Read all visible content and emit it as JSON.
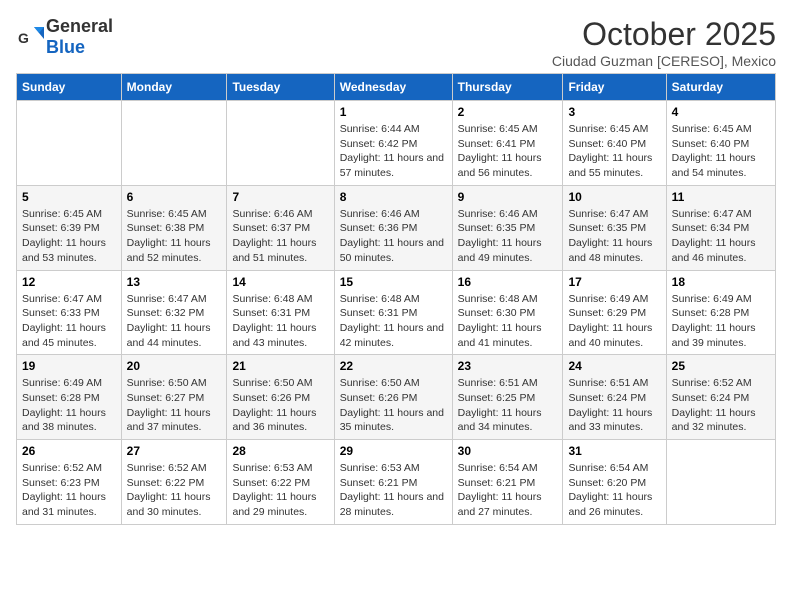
{
  "header": {
    "logo_general": "General",
    "logo_blue": "Blue",
    "title": "October 2025",
    "subtitle": "Ciudad Guzman [CERESO], Mexico"
  },
  "weekdays": [
    "Sunday",
    "Monday",
    "Tuesday",
    "Wednesday",
    "Thursday",
    "Friday",
    "Saturday"
  ],
  "weeks": [
    [
      {
        "day": "",
        "info": ""
      },
      {
        "day": "",
        "info": ""
      },
      {
        "day": "",
        "info": ""
      },
      {
        "day": "1",
        "info": "Sunrise: 6:44 AM\nSunset: 6:42 PM\nDaylight: 11 hours and 57 minutes."
      },
      {
        "day": "2",
        "info": "Sunrise: 6:45 AM\nSunset: 6:41 PM\nDaylight: 11 hours and 56 minutes."
      },
      {
        "day": "3",
        "info": "Sunrise: 6:45 AM\nSunset: 6:40 PM\nDaylight: 11 hours and 55 minutes."
      },
      {
        "day": "4",
        "info": "Sunrise: 6:45 AM\nSunset: 6:40 PM\nDaylight: 11 hours and 54 minutes."
      }
    ],
    [
      {
        "day": "5",
        "info": "Sunrise: 6:45 AM\nSunset: 6:39 PM\nDaylight: 11 hours and 53 minutes."
      },
      {
        "day": "6",
        "info": "Sunrise: 6:45 AM\nSunset: 6:38 PM\nDaylight: 11 hours and 52 minutes."
      },
      {
        "day": "7",
        "info": "Sunrise: 6:46 AM\nSunset: 6:37 PM\nDaylight: 11 hours and 51 minutes."
      },
      {
        "day": "8",
        "info": "Sunrise: 6:46 AM\nSunset: 6:36 PM\nDaylight: 11 hours and 50 minutes."
      },
      {
        "day": "9",
        "info": "Sunrise: 6:46 AM\nSunset: 6:35 PM\nDaylight: 11 hours and 49 minutes."
      },
      {
        "day": "10",
        "info": "Sunrise: 6:47 AM\nSunset: 6:35 PM\nDaylight: 11 hours and 48 minutes."
      },
      {
        "day": "11",
        "info": "Sunrise: 6:47 AM\nSunset: 6:34 PM\nDaylight: 11 hours and 46 minutes."
      }
    ],
    [
      {
        "day": "12",
        "info": "Sunrise: 6:47 AM\nSunset: 6:33 PM\nDaylight: 11 hours and 45 minutes."
      },
      {
        "day": "13",
        "info": "Sunrise: 6:47 AM\nSunset: 6:32 PM\nDaylight: 11 hours and 44 minutes."
      },
      {
        "day": "14",
        "info": "Sunrise: 6:48 AM\nSunset: 6:31 PM\nDaylight: 11 hours and 43 minutes."
      },
      {
        "day": "15",
        "info": "Sunrise: 6:48 AM\nSunset: 6:31 PM\nDaylight: 11 hours and 42 minutes."
      },
      {
        "day": "16",
        "info": "Sunrise: 6:48 AM\nSunset: 6:30 PM\nDaylight: 11 hours and 41 minutes."
      },
      {
        "day": "17",
        "info": "Sunrise: 6:49 AM\nSunset: 6:29 PM\nDaylight: 11 hours and 40 minutes."
      },
      {
        "day": "18",
        "info": "Sunrise: 6:49 AM\nSunset: 6:28 PM\nDaylight: 11 hours and 39 minutes."
      }
    ],
    [
      {
        "day": "19",
        "info": "Sunrise: 6:49 AM\nSunset: 6:28 PM\nDaylight: 11 hours and 38 minutes."
      },
      {
        "day": "20",
        "info": "Sunrise: 6:50 AM\nSunset: 6:27 PM\nDaylight: 11 hours and 37 minutes."
      },
      {
        "day": "21",
        "info": "Sunrise: 6:50 AM\nSunset: 6:26 PM\nDaylight: 11 hours and 36 minutes."
      },
      {
        "day": "22",
        "info": "Sunrise: 6:50 AM\nSunset: 6:26 PM\nDaylight: 11 hours and 35 minutes."
      },
      {
        "day": "23",
        "info": "Sunrise: 6:51 AM\nSunset: 6:25 PM\nDaylight: 11 hours and 34 minutes."
      },
      {
        "day": "24",
        "info": "Sunrise: 6:51 AM\nSunset: 6:24 PM\nDaylight: 11 hours and 33 minutes."
      },
      {
        "day": "25",
        "info": "Sunrise: 6:52 AM\nSunset: 6:24 PM\nDaylight: 11 hours and 32 minutes."
      }
    ],
    [
      {
        "day": "26",
        "info": "Sunrise: 6:52 AM\nSunset: 6:23 PM\nDaylight: 11 hours and 31 minutes."
      },
      {
        "day": "27",
        "info": "Sunrise: 6:52 AM\nSunset: 6:22 PM\nDaylight: 11 hours and 30 minutes."
      },
      {
        "day": "28",
        "info": "Sunrise: 6:53 AM\nSunset: 6:22 PM\nDaylight: 11 hours and 29 minutes."
      },
      {
        "day": "29",
        "info": "Sunrise: 6:53 AM\nSunset: 6:21 PM\nDaylight: 11 hours and 28 minutes."
      },
      {
        "day": "30",
        "info": "Sunrise: 6:54 AM\nSunset: 6:21 PM\nDaylight: 11 hours and 27 minutes."
      },
      {
        "day": "31",
        "info": "Sunrise: 6:54 AM\nSunset: 6:20 PM\nDaylight: 11 hours and 26 minutes."
      },
      {
        "day": "",
        "info": ""
      }
    ]
  ]
}
